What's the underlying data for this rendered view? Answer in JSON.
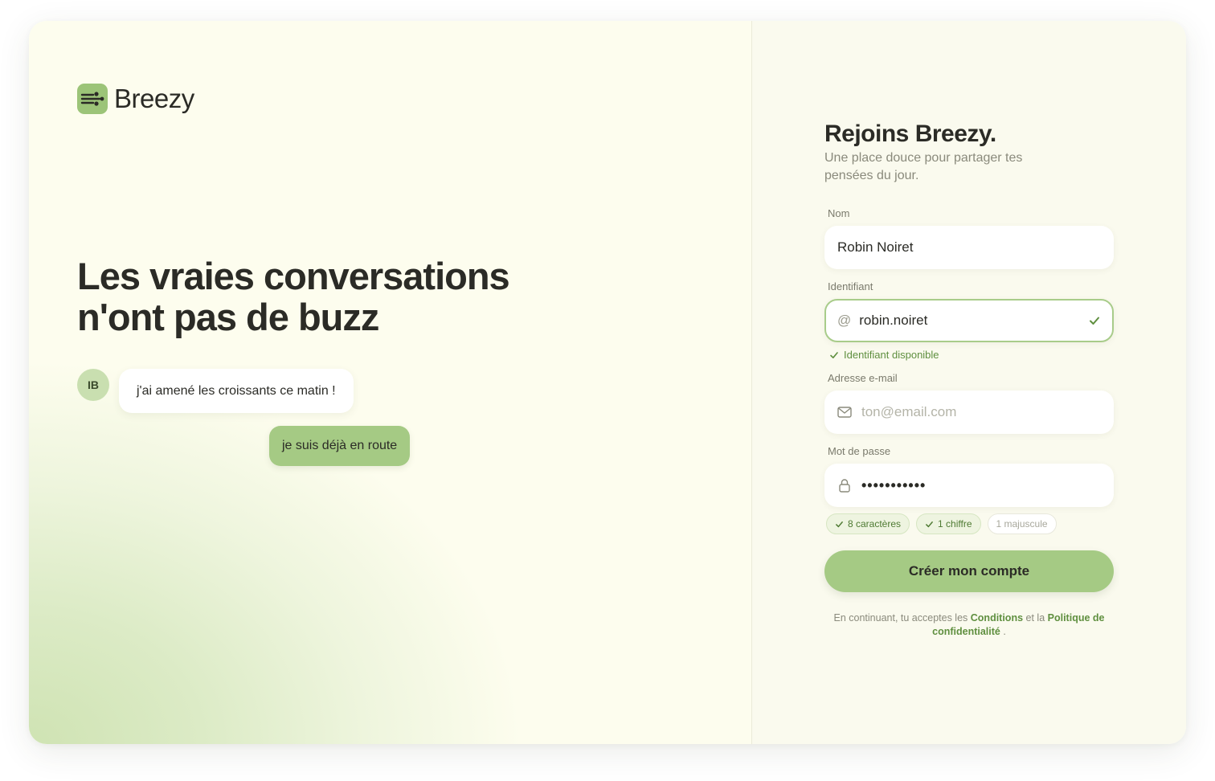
{
  "brand": {
    "name": "Breezy",
    "accent": "#a5ca84",
    "logo_icon": "wind-icon"
  },
  "hero": {
    "line1": "Les vraies conversations",
    "line2": "n'ont pas de buzz"
  },
  "chat": {
    "avatar_initials": "IB",
    "incoming": "j'ai amené les croissants ce matin !",
    "outgoing": "je suis déjà en route"
  },
  "form": {
    "title": "Rejoins Breezy.",
    "subtitle": "Une place douce pour partager tes pensées du jour.",
    "name": {
      "label": "Nom",
      "value": "Robin Noiret"
    },
    "handle": {
      "label": "Identifiant",
      "prefix": "@",
      "value": "robin.noiret",
      "status": "Identifiant disponible"
    },
    "email": {
      "label": "Adresse e-mail",
      "placeholder": "ton@email.com",
      "value": ""
    },
    "password": {
      "label": "Mot de passe",
      "masked": "•••••••••••",
      "rules": [
        {
          "label": "8 caractères",
          "met": true
        },
        {
          "label": "1 chiffre",
          "met": true
        },
        {
          "label": "1 majuscule",
          "met": false
        }
      ]
    },
    "submit_label": "Créer mon compte",
    "legal": {
      "prefix": "En continuant, tu acceptes les",
      "terms": "Conditions",
      "middle": "et la",
      "privacy": "Politique de confidentialité",
      "suffix": "."
    }
  }
}
